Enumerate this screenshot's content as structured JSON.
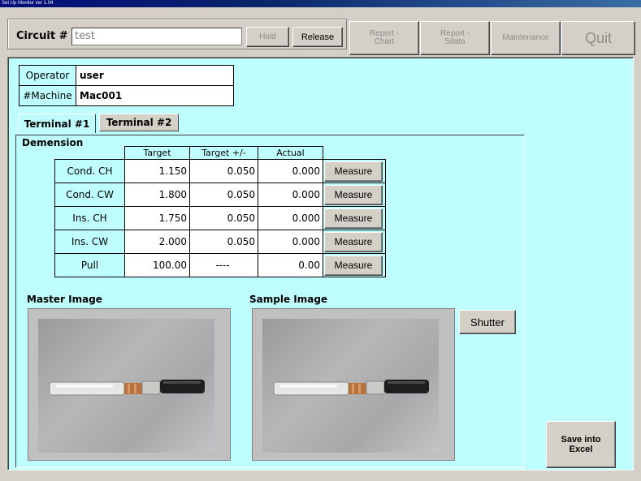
{
  "window": {
    "title": "Set Up Monitor ver 1.04"
  },
  "toolbar": {
    "circuit_label": "Circuit #",
    "circuit_value": "test",
    "hold_label": "Hold",
    "release_label": "Release",
    "report_chart_line1": "Report -",
    "report_chart_line2": "Chart",
    "report_5data_line1": "Report -",
    "report_5data_line2": "5data",
    "maintenance_label": "Maintenance",
    "quit_label": "Quit"
  },
  "info": {
    "operator_label": "Operator",
    "operator_value": "user",
    "machine_label": "#Machine",
    "machine_value": "Mac001"
  },
  "tabs": [
    {
      "label": "Terminal #1",
      "active": true
    },
    {
      "label": "Terminal #2",
      "active": false
    }
  ],
  "dimension": {
    "section_label": "Demension",
    "headers": [
      "Target",
      "Target +/-",
      "Actual"
    ],
    "rows": [
      {
        "name": "Cond. CH",
        "target": "1.150",
        "tol": "0.050",
        "actual": "0.000",
        "button": "Measure"
      },
      {
        "name": "Cond. CW",
        "target": "1.800",
        "tol": "0.050",
        "actual": "0.000",
        "button": "Measure"
      },
      {
        "name": "Ins. CH",
        "target": "1.750",
        "tol": "0.050",
        "actual": "0.000",
        "button": "Measure"
      },
      {
        "name": "Ins. CW",
        "target": "2.000",
        "tol": "0.050",
        "actual": "0.000",
        "button": "Measure"
      },
      {
        "name": "Pull",
        "target": "100.00",
        "tol": "----",
        "actual": "0.00",
        "button": "Measure"
      }
    ]
  },
  "images": {
    "master_label": "Master Image",
    "sample_label": "Sample Image",
    "shutter_label": "Shutter"
  },
  "actions": {
    "save_line1": "Save into",
    "save_line2": "Excel"
  },
  "colors": {
    "panel_bg": "#bffefe",
    "window_bg": "#d4d0c8",
    "titlebar": "#0a246a"
  }
}
